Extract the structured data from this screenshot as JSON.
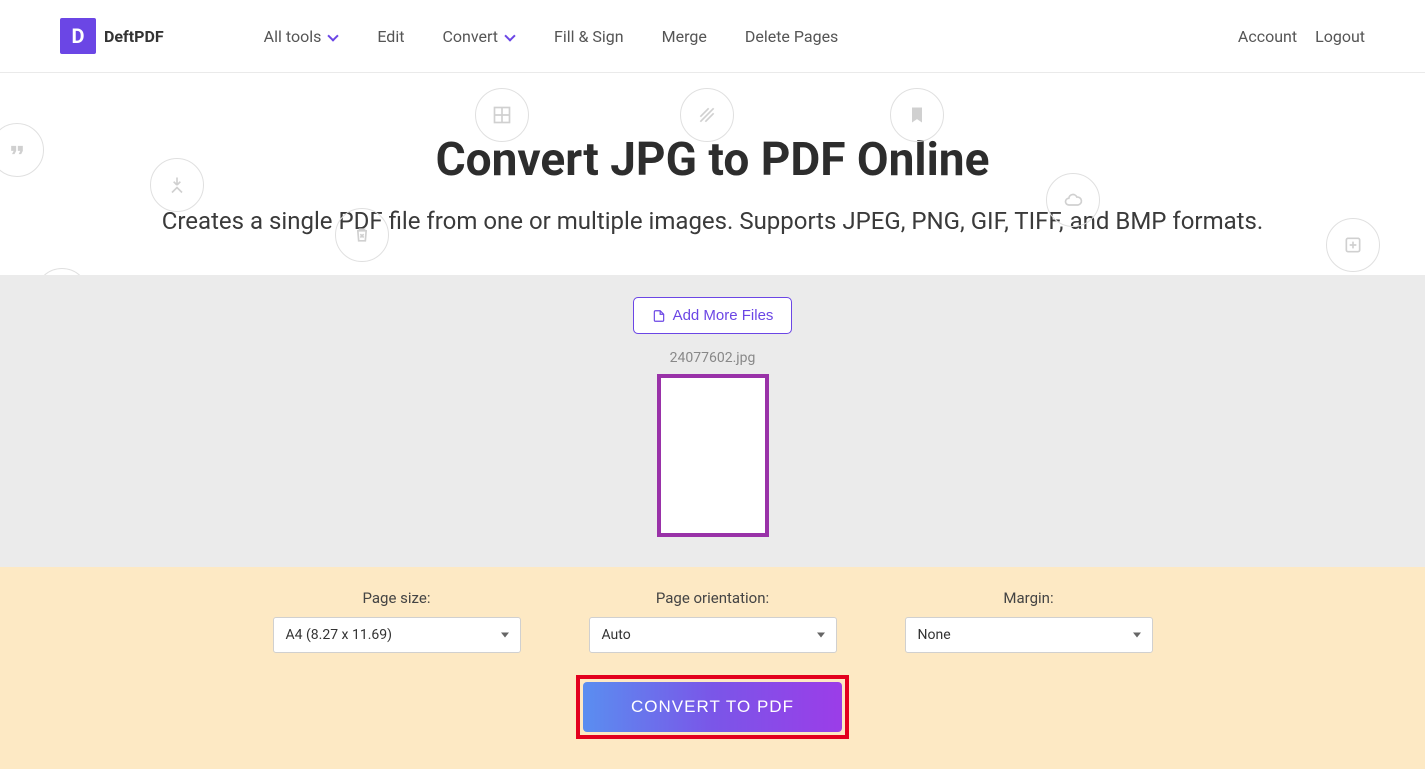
{
  "brand": {
    "name": "DeftPDF",
    "letter": "D"
  },
  "nav": {
    "all_tools": "All tools",
    "edit": "Edit",
    "convert": "Convert",
    "fill_sign": "Fill & Sign",
    "merge": "Merge",
    "delete_pages": "Delete Pages"
  },
  "account": {
    "account": "Account",
    "logout": "Logout"
  },
  "hero": {
    "title": "Convert JPG to PDF Online",
    "subtitle": "Creates a single PDF file from one or multiple images. Supports JPEG, PNG, GIF, TIFF, and BMP formats."
  },
  "upload": {
    "add_more": "Add More Files",
    "filename": "24077602.jpg"
  },
  "options": {
    "page_size": {
      "label": "Page size:",
      "value": "A4 (8.27 x 11.69)"
    },
    "orientation": {
      "label": "Page orientation:",
      "value": "Auto"
    },
    "margin": {
      "label": "Margin:",
      "value": "None"
    }
  },
  "convert": {
    "label": "CONVERT TO PDF"
  }
}
